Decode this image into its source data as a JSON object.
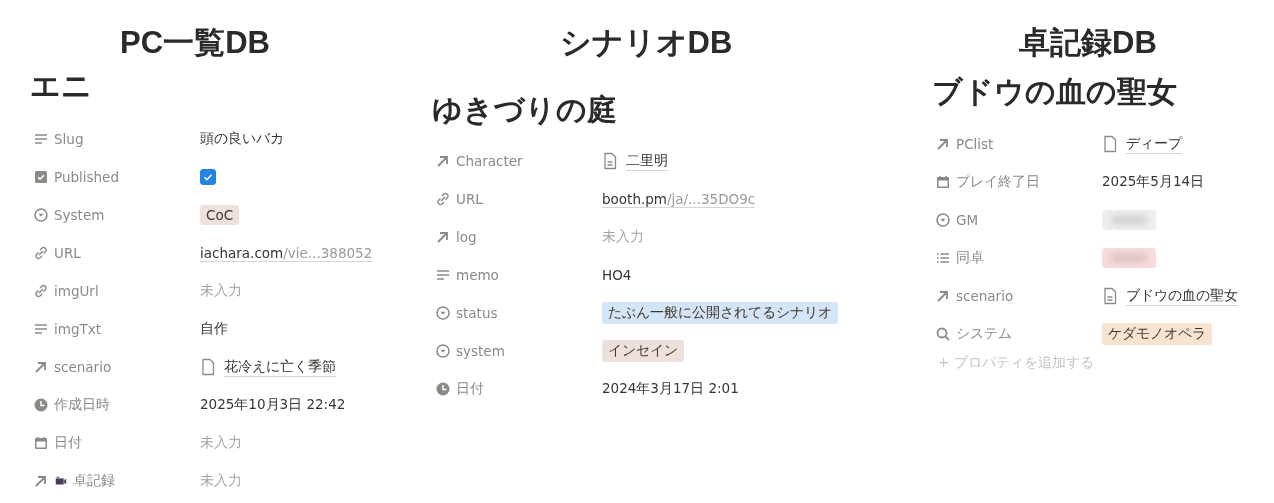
{
  "columns": [
    {
      "heading": "PC一覧DB",
      "title": "エニ",
      "properties": [
        {
          "kind": "text",
          "name": "Slug",
          "value": {
            "kind": "text",
            "text": "頭の良いバカ"
          }
        },
        {
          "kind": "checkbox",
          "name": "Published",
          "value": {
            "kind": "checkbox",
            "checked": true
          }
        },
        {
          "kind": "select",
          "name": "System",
          "value": {
            "kind": "tag",
            "text": "CoC",
            "color": "#eee0da"
          }
        },
        {
          "kind": "link",
          "name": "URL",
          "value": {
            "kind": "url",
            "text": "iachara.com",
            "rest": "/vie...388052"
          }
        },
        {
          "kind": "link",
          "name": "imgUrl",
          "value": {
            "kind": "empty",
            "text": "未入力"
          }
        },
        {
          "kind": "text",
          "name": "imgTxt",
          "value": {
            "kind": "text",
            "text": "自作"
          }
        },
        {
          "kind": "relation",
          "name": "scenario",
          "value": {
            "kind": "page",
            "text": "花冷えに亡く季節"
          }
        },
        {
          "kind": "created",
          "name": "作成日時",
          "value": {
            "kind": "text",
            "text": "2025年10月3日 22:42"
          }
        },
        {
          "kind": "date",
          "name": "日付",
          "value": {
            "kind": "empty",
            "text": "未入力"
          }
        },
        {
          "kind": "relation2",
          "name": "卓記録",
          "value": {
            "kind": "empty",
            "text": "未入力"
          }
        }
      ]
    },
    {
      "heading": "シナリオDB",
      "title": "ゆきづりの庭",
      "properties": [
        {
          "kind": "relation",
          "name": "Character",
          "value": {
            "kind": "doc",
            "text": "二里明"
          }
        },
        {
          "kind": "link",
          "name": "URL",
          "value": {
            "kind": "url",
            "text": "booth.pm",
            "rest": "/ja/...35DO9c"
          }
        },
        {
          "kind": "relation",
          "name": "log",
          "value": {
            "kind": "empty",
            "text": "未入力"
          }
        },
        {
          "kind": "text",
          "name": "memo",
          "value": {
            "kind": "text",
            "text": "HO4"
          }
        },
        {
          "kind": "select",
          "name": "status",
          "value": {
            "kind": "tag",
            "text": "たぶん一般に公開されてるシナリオ",
            "color": "#d3e5f7"
          }
        },
        {
          "kind": "select",
          "name": "system",
          "value": {
            "kind": "tag",
            "text": "インセイン",
            "color": "#eee0da"
          }
        },
        {
          "kind": "created",
          "name": "日付",
          "value": {
            "kind": "text",
            "text": "2024年3月17日 2:01"
          }
        }
      ]
    },
    {
      "heading": "卓記録DB",
      "title": "ブドウの血の聖女",
      "properties": [
        {
          "kind": "relation",
          "name": "PClist",
          "value": {
            "kind": "page",
            "text": "ディープ"
          }
        },
        {
          "kind": "date",
          "name": "プレイ終了日",
          "value": {
            "kind": "text",
            "text": "2025年5月14日"
          }
        },
        {
          "kind": "select",
          "name": "GM",
          "value": {
            "kind": "blurred",
            "color": "#eeeeed"
          }
        },
        {
          "kind": "multi",
          "name": "同卓",
          "value": {
            "kind": "blurred",
            "color": "#f8dcdc"
          }
        },
        {
          "kind": "relation",
          "name": "scenario",
          "value": {
            "kind": "doc",
            "text": "ブドウの血の聖女"
          }
        },
        {
          "kind": "rollup",
          "name": "システム",
          "value": {
            "kind": "tag",
            "text": "ケダモノオペラ",
            "color": "#f8e2d0"
          }
        }
      ],
      "add_property": "+ プロパティを追加する"
    }
  ]
}
